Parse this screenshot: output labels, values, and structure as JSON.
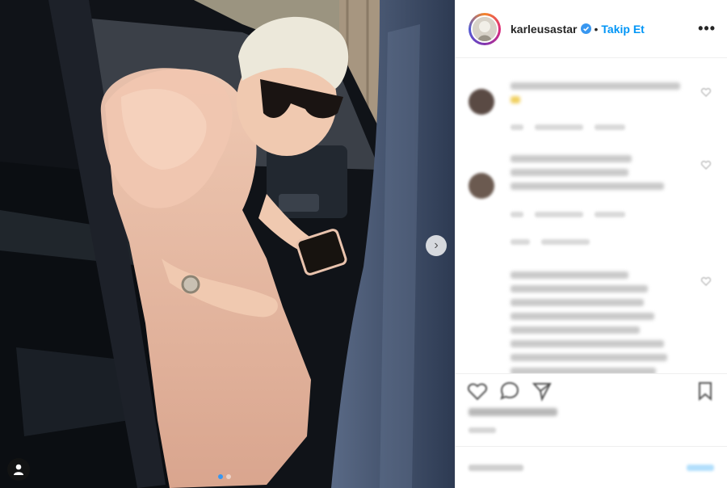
{
  "post": {
    "username": "karleusastar",
    "separator": "•",
    "follow_label": "Takip Et",
    "more_glyph": "•••",
    "next_glyph": "›",
    "carousel": {
      "count": 2,
      "active_index": 0
    }
  },
  "colors": {
    "accent": "#0095f6",
    "verified": "#3897f0",
    "dress": "#e8b9a1",
    "hair": "#e9e4d6"
  },
  "icons": [
    "verified-badge-icon",
    "more-options-icon",
    "next-arrow-icon",
    "user-tag-icon",
    "heart-icon",
    "comment-icon",
    "share-icon",
    "bookmark-icon"
  ],
  "comments": [
    {
      "lines": [
        210,
        12
      ],
      "meta": [
        16,
        60,
        38
      ]
    },
    {
      "lines": [
        150,
        146,
        190
      ],
      "meta": [
        16,
        60,
        38
      ]
    },
    {
      "lines": [
        146,
        170,
        165,
        178,
        160,
        190,
        194,
        180
      ],
      "meta": []
    }
  ]
}
